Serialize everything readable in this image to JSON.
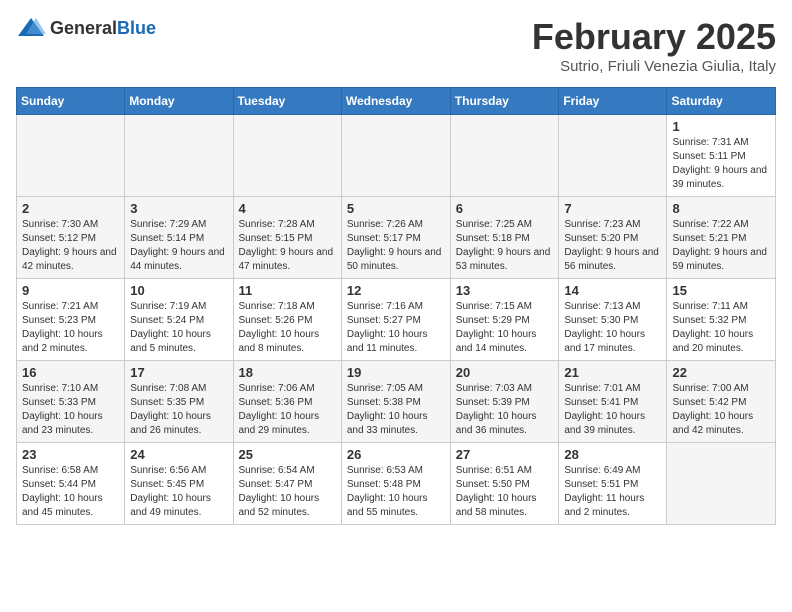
{
  "logo": {
    "general": "General",
    "blue": "Blue"
  },
  "title": "February 2025",
  "subtitle": "Sutrio, Friuli Venezia Giulia, Italy",
  "headers": [
    "Sunday",
    "Monday",
    "Tuesday",
    "Wednesday",
    "Thursday",
    "Friday",
    "Saturday"
  ],
  "weeks": [
    [
      {
        "day": "",
        "info": ""
      },
      {
        "day": "",
        "info": ""
      },
      {
        "day": "",
        "info": ""
      },
      {
        "day": "",
        "info": ""
      },
      {
        "day": "",
        "info": ""
      },
      {
        "day": "",
        "info": ""
      },
      {
        "day": "1",
        "info": "Sunrise: 7:31 AM\nSunset: 5:11 PM\nDaylight: 9 hours and 39 minutes."
      }
    ],
    [
      {
        "day": "2",
        "info": "Sunrise: 7:30 AM\nSunset: 5:12 PM\nDaylight: 9 hours and 42 minutes."
      },
      {
        "day": "3",
        "info": "Sunrise: 7:29 AM\nSunset: 5:14 PM\nDaylight: 9 hours and 44 minutes."
      },
      {
        "day": "4",
        "info": "Sunrise: 7:28 AM\nSunset: 5:15 PM\nDaylight: 9 hours and 47 minutes."
      },
      {
        "day": "5",
        "info": "Sunrise: 7:26 AM\nSunset: 5:17 PM\nDaylight: 9 hours and 50 minutes."
      },
      {
        "day": "6",
        "info": "Sunrise: 7:25 AM\nSunset: 5:18 PM\nDaylight: 9 hours and 53 minutes."
      },
      {
        "day": "7",
        "info": "Sunrise: 7:23 AM\nSunset: 5:20 PM\nDaylight: 9 hours and 56 minutes."
      },
      {
        "day": "8",
        "info": "Sunrise: 7:22 AM\nSunset: 5:21 PM\nDaylight: 9 hours and 59 minutes."
      }
    ],
    [
      {
        "day": "9",
        "info": "Sunrise: 7:21 AM\nSunset: 5:23 PM\nDaylight: 10 hours and 2 minutes."
      },
      {
        "day": "10",
        "info": "Sunrise: 7:19 AM\nSunset: 5:24 PM\nDaylight: 10 hours and 5 minutes."
      },
      {
        "day": "11",
        "info": "Sunrise: 7:18 AM\nSunset: 5:26 PM\nDaylight: 10 hours and 8 minutes."
      },
      {
        "day": "12",
        "info": "Sunrise: 7:16 AM\nSunset: 5:27 PM\nDaylight: 10 hours and 11 minutes."
      },
      {
        "day": "13",
        "info": "Sunrise: 7:15 AM\nSunset: 5:29 PM\nDaylight: 10 hours and 14 minutes."
      },
      {
        "day": "14",
        "info": "Sunrise: 7:13 AM\nSunset: 5:30 PM\nDaylight: 10 hours and 17 minutes."
      },
      {
        "day": "15",
        "info": "Sunrise: 7:11 AM\nSunset: 5:32 PM\nDaylight: 10 hours and 20 minutes."
      }
    ],
    [
      {
        "day": "16",
        "info": "Sunrise: 7:10 AM\nSunset: 5:33 PM\nDaylight: 10 hours and 23 minutes."
      },
      {
        "day": "17",
        "info": "Sunrise: 7:08 AM\nSunset: 5:35 PM\nDaylight: 10 hours and 26 minutes."
      },
      {
        "day": "18",
        "info": "Sunrise: 7:06 AM\nSunset: 5:36 PM\nDaylight: 10 hours and 29 minutes."
      },
      {
        "day": "19",
        "info": "Sunrise: 7:05 AM\nSunset: 5:38 PM\nDaylight: 10 hours and 33 minutes."
      },
      {
        "day": "20",
        "info": "Sunrise: 7:03 AM\nSunset: 5:39 PM\nDaylight: 10 hours and 36 minutes."
      },
      {
        "day": "21",
        "info": "Sunrise: 7:01 AM\nSunset: 5:41 PM\nDaylight: 10 hours and 39 minutes."
      },
      {
        "day": "22",
        "info": "Sunrise: 7:00 AM\nSunset: 5:42 PM\nDaylight: 10 hours and 42 minutes."
      }
    ],
    [
      {
        "day": "23",
        "info": "Sunrise: 6:58 AM\nSunset: 5:44 PM\nDaylight: 10 hours and 45 minutes."
      },
      {
        "day": "24",
        "info": "Sunrise: 6:56 AM\nSunset: 5:45 PM\nDaylight: 10 hours and 49 minutes."
      },
      {
        "day": "25",
        "info": "Sunrise: 6:54 AM\nSunset: 5:47 PM\nDaylight: 10 hours and 52 minutes."
      },
      {
        "day": "26",
        "info": "Sunrise: 6:53 AM\nSunset: 5:48 PM\nDaylight: 10 hours and 55 minutes."
      },
      {
        "day": "27",
        "info": "Sunrise: 6:51 AM\nSunset: 5:50 PM\nDaylight: 10 hours and 58 minutes."
      },
      {
        "day": "28",
        "info": "Sunrise: 6:49 AM\nSunset: 5:51 PM\nDaylight: 11 hours and 2 minutes."
      },
      {
        "day": "",
        "info": ""
      }
    ]
  ]
}
